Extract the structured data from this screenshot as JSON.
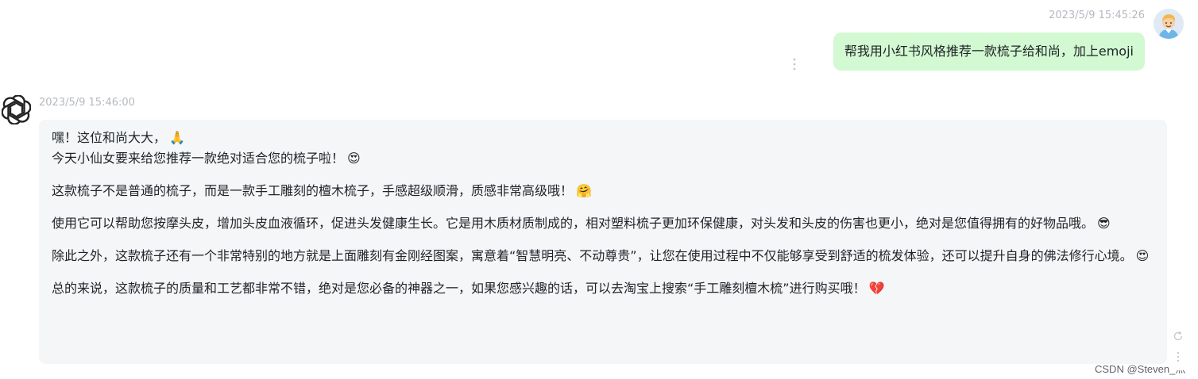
{
  "user_message": {
    "timestamp": "2023/5/9 15:45:26",
    "text": "帮我用小红书风格推荐一款梳子给和尚，加上emoji"
  },
  "assistant_message": {
    "timestamp": "2023/5/9 15:46:00",
    "paragraphs": [
      {
        "lines": [
          "嘿！这位和尚大大，",
          "今天小仙女要来给您推荐一款绝对适合您的梳子啦！"
        ],
        "emojis": [
          "🙏",
          "😍"
        ]
      },
      {
        "text": "这款梳子不是普通的梳子，而是一款手工雕刻的檀木梳子，手感超级顺滑，质感非常高级哦！",
        "emoji": "🤗"
      },
      {
        "text": "使用它可以帮助您按摩头皮，增加头皮血液循环，促进头发健康生长。它是用木质材质制成的，相对塑料梳子更加环保健康，对头发和头皮的伤害也更小，绝对是您值得拥有的好物品哦。",
        "emoji": "😎"
      },
      {
        "text": "除此之外，这款梳子还有一个非常特别的地方就是上面雕刻有金刚经图案，寓意着“智慧明亮、不动尊贵”，让您在使用过程中不仅能够享受到舒适的梳发体验，还可以提升自身的佛法修行心境。",
        "emoji": "😍"
      },
      {
        "text": "总的来说，这款梳子的质量和工艺都非常不错，绝对是您必备的神器之一，如果您感兴趣的话，可以去淘宝上搜索“手工雕刻檀木梳”进行购买哦！",
        "emoji": "💔"
      }
    ]
  },
  "watermark": "CSDN @Steven_灬",
  "colors": {
    "user_bubble": "#d2f9d1",
    "assistant_bubble": "#f4f6f8",
    "timestamp": "#b4b9c0"
  },
  "icons": {
    "user_avatar": "avatar-icon",
    "assistant_avatar": "openai-logo-icon",
    "more": "more-vertical-icon",
    "refresh": "refresh-icon"
  }
}
